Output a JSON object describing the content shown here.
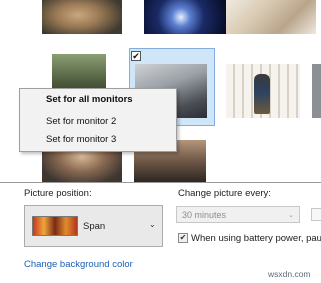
{
  "context_menu": {
    "items": [
      {
        "label": "Set for all monitors",
        "bold": true
      },
      {
        "label": "Set for monitor 2"
      },
      {
        "label": "Set for monitor 3"
      }
    ]
  },
  "selected_picture": {
    "checked": true,
    "check_glyph": "✔"
  },
  "picture_position": {
    "label": "Picture position:",
    "value": "Span",
    "chevron": "⌄"
  },
  "change_picture": {
    "label": "Change picture every:",
    "value": "30 minutes",
    "chevron": "⌄",
    "battery_checkbox": {
      "checked": true,
      "check_glyph": "✔",
      "label": "When using battery power, pau"
    }
  },
  "links": {
    "change_background_color": "Change background color"
  },
  "watermark": "wsxdn.com",
  "colors": {
    "link": "#1a5fb4",
    "selection_fill": "#cfe6f8",
    "selection_border": "#84acdd",
    "menu_bg": "#f2f2f2"
  }
}
